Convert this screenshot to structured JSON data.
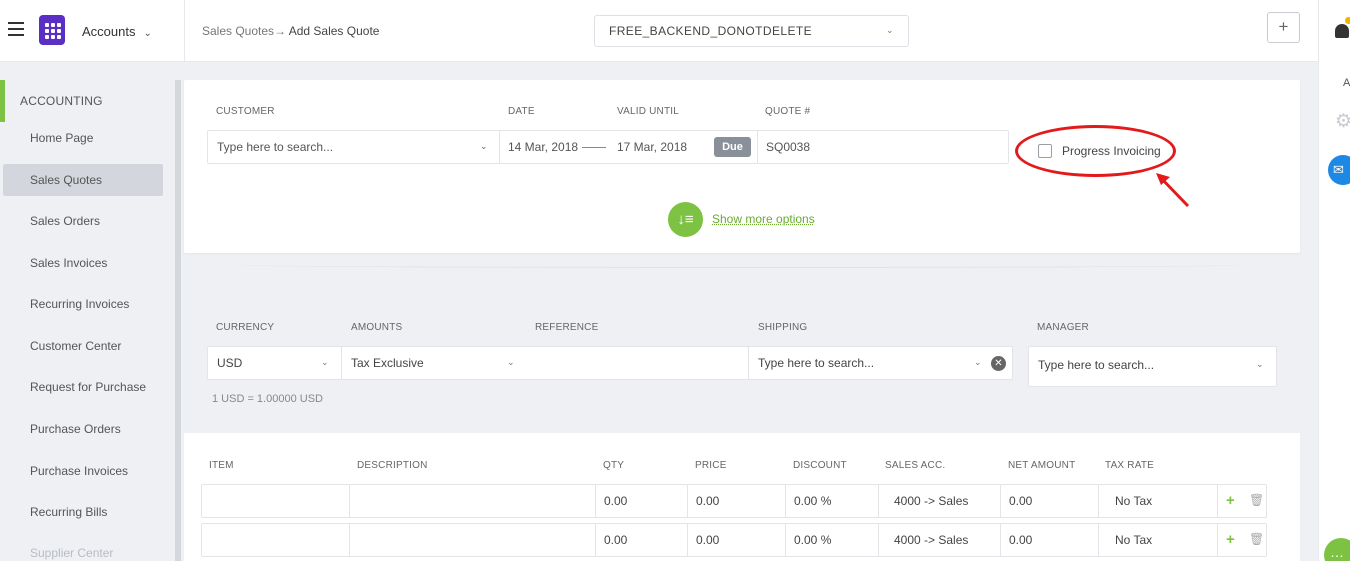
{
  "header": {
    "app_name": "Accounts",
    "breadcrumb_parent": "Sales Quotes",
    "breadcrumb_sep": "→",
    "breadcrumb_current": "Add Sales Quote",
    "org_name": "FREE_BACKEND_DONOTDELETE",
    "plus_label": "+"
  },
  "rightrail": {
    "ai_label": "AI"
  },
  "sidebar": {
    "heading": "ACCOUNTING",
    "items": [
      {
        "label": "Home Page"
      },
      {
        "label": "Sales Quotes",
        "active": true
      },
      {
        "label": "Sales Orders"
      },
      {
        "label": "Sales Invoices"
      },
      {
        "label": "Recurring Invoices"
      },
      {
        "label": "Customer Center"
      },
      {
        "label": "Request for Purchase"
      },
      {
        "label": "Purchase Orders"
      },
      {
        "label": "Purchase Invoices"
      },
      {
        "label": "Recurring Bills"
      },
      {
        "label": "Supplier Center"
      }
    ]
  },
  "form": {
    "labels": {
      "customer": "CUSTOMER",
      "date": "DATE",
      "valid_until": "VALID UNTIL",
      "quote_no": "QUOTE #"
    },
    "customer_placeholder": "Type here to search...",
    "date": "14 Mar, 2018",
    "valid_until": "17 Mar, 2018",
    "due_badge": "Due",
    "quote_no": "SQ0038",
    "progress_invoicing_label": "Progress Invoicing",
    "progress_invoicing_checked": false,
    "show_more": "Show more options"
  },
  "options": {
    "labels": {
      "currency": "CURRENCY",
      "amounts": "AMOUNTS",
      "reference": "REFERENCE",
      "shipping": "SHIPPING",
      "manager": "MANAGER"
    },
    "currency": "USD",
    "amounts": "Tax Exclusive",
    "reference": "",
    "shipping_placeholder": "Type here to search...",
    "manager_placeholder": "Type here to search...",
    "rate_note": "1 USD = 1.00000 USD"
  },
  "lines": {
    "headers": {
      "item": "ITEM",
      "description": "DESCRIPTION",
      "qty": "QTY",
      "price": "PRICE",
      "discount": "DISCOUNT",
      "sales_acc": "SALES ACC.",
      "net_amount": "NET AMOUNT",
      "tax_rate": "TAX RATE"
    },
    "rows": [
      {
        "item": "",
        "description": "",
        "qty": "0.00",
        "price": "0.00",
        "discount": "0.00 %",
        "sales_acc": "4000 -> Sales",
        "net_amount": "0.00",
        "tax_rate": "No Tax"
      },
      {
        "item": "",
        "description": "",
        "qty": "0.00",
        "price": "0.00",
        "discount": "0.00 %",
        "sales_acc": "4000 -> Sales",
        "net_amount": "0.00",
        "tax_rate": "No Tax"
      }
    ]
  },
  "colors": {
    "brand": "#5b2fc4",
    "accent_green": "#7dc242",
    "annotation_red": "#e3191c"
  }
}
